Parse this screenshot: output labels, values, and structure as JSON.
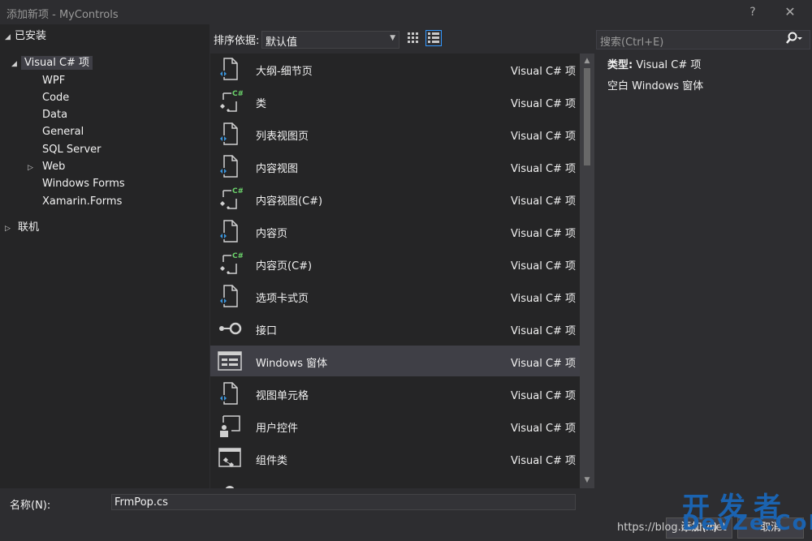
{
  "window": {
    "title": "添加新项 - MyControls",
    "help": "?",
    "close": "✕"
  },
  "tree": {
    "installed": "已安装",
    "visual_csharp": "Visual C# 项",
    "children": [
      "WPF",
      "Code",
      "Data",
      "General",
      "SQL Server",
      "Web",
      "Windows Forms",
      "Xamarin.Forms"
    ],
    "online": "联机"
  },
  "toolbar": {
    "sort_label": "排序依据:",
    "sort_value": "默认值"
  },
  "search": {
    "placeholder": "搜索(Ctrl+E)"
  },
  "items": [
    {
      "name": "大纲-细节页",
      "type": "Visual C# 项",
      "icon": "page-icon"
    },
    {
      "name": "类",
      "type": "Visual C# 项",
      "icon": "class-icon"
    },
    {
      "name": "列表视图页",
      "type": "Visual C# 项",
      "icon": "page-icon"
    },
    {
      "name": "内容视图",
      "type": "Visual C# 项",
      "icon": "page-icon"
    },
    {
      "name": "内容视图(C#)",
      "type": "Visual C# 项",
      "icon": "class-icon"
    },
    {
      "name": "内容页",
      "type": "Visual C# 项",
      "icon": "page-icon"
    },
    {
      "name": "内容页(C#)",
      "type": "Visual C# 项",
      "icon": "class-icon"
    },
    {
      "name": "选项卡式页",
      "type": "Visual C# 项",
      "icon": "page-icon"
    },
    {
      "name": "接口",
      "type": "Visual C# 项",
      "icon": "interface-icon"
    },
    {
      "name": "Windows 窗体",
      "type": "Visual C# 项",
      "icon": "form-icon"
    },
    {
      "name": "视图单元格",
      "type": "Visual C# 项",
      "icon": "page-icon"
    },
    {
      "name": "用户控件",
      "type": "Visual C# 项",
      "icon": "user-control-icon"
    },
    {
      "name": "组件类",
      "type": "Visual C# 项",
      "icon": "component-icon"
    }
  ],
  "selected_index": 9,
  "description": {
    "type_label": "类型:",
    "type_value": "Visual C# 项",
    "text": "空白 Windows 窗体"
  },
  "bottom": {
    "name_label": "名称(N):",
    "name_value": "FrmPop.cs",
    "add_button": "添加(A)",
    "cancel_button": "取消",
    "watermark_url": "https://blog.csdn.net",
    "watermark_cn": "开发者",
    "watermark_en": "DevZe.CoM"
  },
  "colors": {
    "accent": "#3399ff",
    "green": "#6bd36b",
    "blue_dot": "#3a96dd"
  }
}
